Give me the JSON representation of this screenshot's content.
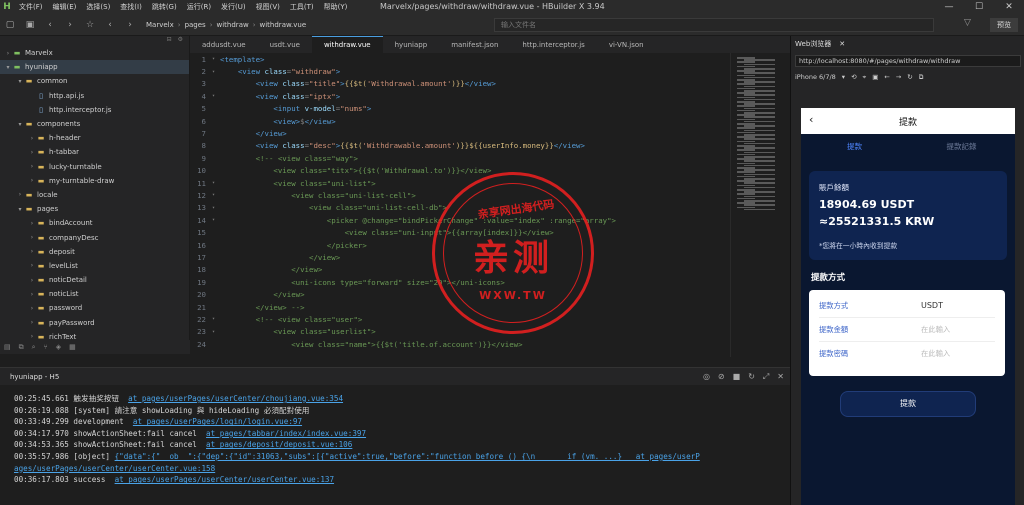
{
  "menubar": {
    "logo": "H",
    "menus": [
      "文件(F)",
      "编辑(E)",
      "选择(S)",
      "查找(I)",
      "跳转(G)",
      "运行(R)",
      "发行(U)",
      "视图(V)",
      "工具(T)",
      "帮助(Y)"
    ],
    "window_title": "Marvelx/pages/withdraw/withdraw.vue - HBuilder X 3.94",
    "controls": [
      "—",
      "☐",
      "✕"
    ]
  },
  "toolbar": {
    "breadcrumbs": [
      "Marvelx",
      "pages",
      "withdraw",
      "withdraw.vue"
    ],
    "file_search_placeholder": "输入文件名",
    "preview_label": "预览"
  },
  "sidebar": {
    "items": [
      {
        "label": "Marvelx",
        "depth": 0,
        "kind": "proj",
        "open": false
      },
      {
        "label": "hyuniapp",
        "depth": 0,
        "kind": "proj",
        "open": true
      },
      {
        "label": "common",
        "depth": 1,
        "kind": "folder",
        "open": true
      },
      {
        "label": "http.api.js",
        "depth": 2,
        "kind": "file",
        "open": null
      },
      {
        "label": "http.interceptor.js",
        "depth": 2,
        "kind": "file",
        "open": null
      },
      {
        "label": "components",
        "depth": 1,
        "kind": "folder",
        "open": true
      },
      {
        "label": "h-header",
        "depth": 2,
        "kind": "folder",
        "open": false
      },
      {
        "label": "h-tabbar",
        "depth": 2,
        "kind": "folder",
        "open": false
      },
      {
        "label": "lucky-turntable",
        "depth": 2,
        "kind": "folder",
        "open": false
      },
      {
        "label": "my-turntable-draw",
        "depth": 2,
        "kind": "folder",
        "open": false
      },
      {
        "label": "locale",
        "depth": 1,
        "kind": "folder",
        "open": false
      },
      {
        "label": "pages",
        "depth": 1,
        "kind": "folder",
        "open": true
      },
      {
        "label": "bindAccount",
        "depth": 2,
        "kind": "folder",
        "open": false
      },
      {
        "label": "companyDesc",
        "depth": 2,
        "kind": "folder",
        "open": false
      },
      {
        "label": "deposit",
        "depth": 2,
        "kind": "folder",
        "open": false
      },
      {
        "label": "levelList",
        "depth": 2,
        "kind": "folder",
        "open": false
      },
      {
        "label": "noticDetail",
        "depth": 2,
        "kind": "folder",
        "open": false
      },
      {
        "label": "noticList",
        "depth": 2,
        "kind": "folder",
        "open": false
      },
      {
        "label": "password",
        "depth": 2,
        "kind": "folder",
        "open": false
      },
      {
        "label": "payPassword",
        "depth": 2,
        "kind": "folder",
        "open": false
      },
      {
        "label": "richText",
        "depth": 2,
        "kind": "folder",
        "open": false
      }
    ]
  },
  "tabs": [
    {
      "label": "addusdt.vue",
      "active": false
    },
    {
      "label": "usdt.vue",
      "active": false
    },
    {
      "label": "withdraw.vue",
      "active": true
    },
    {
      "label": "hyuniapp",
      "active": false
    },
    {
      "label": "manifest.json",
      "active": false
    },
    {
      "label": "http.interceptor.js",
      "active": false
    },
    {
      "label": "vi-VN.json",
      "active": false
    }
  ],
  "code_lines": [
    [
      [
        "t",
        "<template>"
      ]
    ],
    [
      [
        "o",
        "    "
      ],
      [
        "t",
        "<view "
      ],
      [
        "a",
        "class"
      ],
      [
        "o",
        "="
      ],
      [
        "s",
        "\"withdraw\""
      ],
      [
        "t",
        ">"
      ]
    ],
    [
      [
        "o",
        "        "
      ],
      [
        "t",
        "<view "
      ],
      [
        "a",
        "class"
      ],
      [
        "o",
        "="
      ],
      [
        "s",
        "\"title\""
      ],
      [
        "t",
        ">"
      ],
      [
        "v",
        "{{$t("
      ],
      [
        "s",
        "'Withdrawal.amount'"
      ],
      [
        "v",
        ")}}"
      ],
      [
        "t",
        "</view>"
      ]
    ],
    [
      [
        "o",
        "        "
      ],
      [
        "t",
        "<view "
      ],
      [
        "a",
        "class"
      ],
      [
        "o",
        "="
      ],
      [
        "s",
        "\"iptx\""
      ],
      [
        "t",
        ">"
      ]
    ],
    [
      [
        "o",
        "            "
      ],
      [
        "t",
        "<input "
      ],
      [
        "a",
        "v-model"
      ],
      [
        "o",
        "="
      ],
      [
        "s",
        "\"nums\""
      ],
      [
        "t",
        ">"
      ]
    ],
    [
      [
        "o",
        "            "
      ],
      [
        "t",
        "<view>"
      ],
      [
        "o",
        "$"
      ],
      [
        "t",
        "</view>"
      ]
    ],
    [
      [
        "o",
        "        "
      ],
      [
        "t",
        "</view>"
      ]
    ],
    [
      [
        "o",
        "        "
      ],
      [
        "t",
        "<view "
      ],
      [
        "a",
        "class"
      ],
      [
        "o",
        "="
      ],
      [
        "s",
        "\"desc\""
      ],
      [
        "t",
        ">"
      ],
      [
        "v",
        "{{$t("
      ],
      [
        "s",
        "'Withdrawable.amount'"
      ],
      [
        "v",
        ")}}${{userInfo.money}}"
      ],
      [
        "t",
        "</view>"
      ]
    ],
    [
      [
        "c",
        "        <!-- <view class=\"way\">"
      ]
    ],
    [
      [
        "c",
        "            <view class=\"titx\">{{$t('Withdrawal.to')}}</view>"
      ]
    ],
    [
      [
        "c",
        "            <view class=\"uni-list\">"
      ]
    ],
    [
      [
        "c",
        "                <view class=\"uni-list-cell\">"
      ]
    ],
    [
      [
        "c",
        "                    <view class=\"uni-list-cell-db\">"
      ]
    ],
    [
      [
        "c",
        "                        <picker @change=\"bindPickerChange\" :value=\"index\" :range=\"array\">"
      ]
    ],
    [
      [
        "c",
        "                            <view class=\"uni-input\">{{array[index]}}</view>"
      ]
    ],
    [
      [
        "c",
        "                        </picker>"
      ]
    ],
    [
      [
        "c",
        "                    </view>"
      ]
    ],
    [
      [
        "c",
        "                </view>"
      ]
    ],
    [
      [
        "c",
        "                <uni-icons type=\"forward\" size=\"20\"></uni-icons>"
      ]
    ],
    [
      [
        "c",
        "            </view>"
      ]
    ],
    [
      [
        "c",
        "        </view> -->"
      ]
    ],
    [
      [
        "c",
        "        <!-- <view class=\"user\">"
      ]
    ],
    [
      [
        "c",
        "            <view class=\"userlist\">"
      ]
    ],
    [
      [
        "c",
        "                <view class=\"name\">{{$t('title.of.account')}}</view>"
      ]
    ]
  ],
  "watermark": {
    "top": "亲享网出海代码",
    "main": "亲测",
    "bottom": "WXW.TW"
  },
  "console": {
    "tab": "hyuniapp - H5",
    "logs": [
      {
        "text": "00:25:45.661 触发抽奖按钮  ",
        "link": "at pages/userPages/userCenter/choujiang.vue:354"
      },
      {
        "text": "00:26:19.088 [system] 請注意 showLoading 與 hideLoading 必須配對使用",
        "link": ""
      },
      {
        "text": "00:33:49.299 development  ",
        "link": "at pages/userPages/login/login.vue:97"
      },
      {
        "text": "00:34:17.970 showActionSheet:fail cancel  ",
        "link": "at pages/tabbar/index/index.vue:397"
      },
      {
        "text": "00:34:53.365 showActionSheet:fail cancel  ",
        "link": "at pages/deposit/deposit.vue:106"
      },
      {
        "text": "00:35:57.986 [object] ",
        "link": "{\"data\":{\"__ob__\":{\"dep\":{\"id\":31063,\"subs\":[{\"active\":true,\"before\":\"function before () {\\n       if (vm._...}   at pages/userP"
      },
      {
        "text": "",
        "link": "ages/userPages/userCenter/userCenter.vue:158"
      },
      {
        "text": "00:36:17.803 success  ",
        "link": "at pages/userPages/userCenter/userCenter.vue:137"
      }
    ]
  },
  "browser": {
    "tab": "Web浏览器",
    "url": "http://localhost:8080/#/pages/withdraw/withdraw",
    "device": "iPhone 6/7/8",
    "phone": {
      "title": "提款",
      "tabs": [
        "提款",
        "提款記錄"
      ],
      "card_label": "賬戶餘額",
      "usdt": "18904.69 USDT",
      "krw": "≈25521331.5 KRW",
      "note": "*您將在一小時內收到提款",
      "section": "提款方式",
      "form": [
        {
          "k": "提款方式",
          "v": "USDT",
          "dark": true
        },
        {
          "k": "提款金額",
          "v": "在此輸入",
          "dark": false
        },
        {
          "k": "提款密碼",
          "v": "在此輸入",
          "dark": false
        }
      ],
      "submit": "提款"
    }
  }
}
